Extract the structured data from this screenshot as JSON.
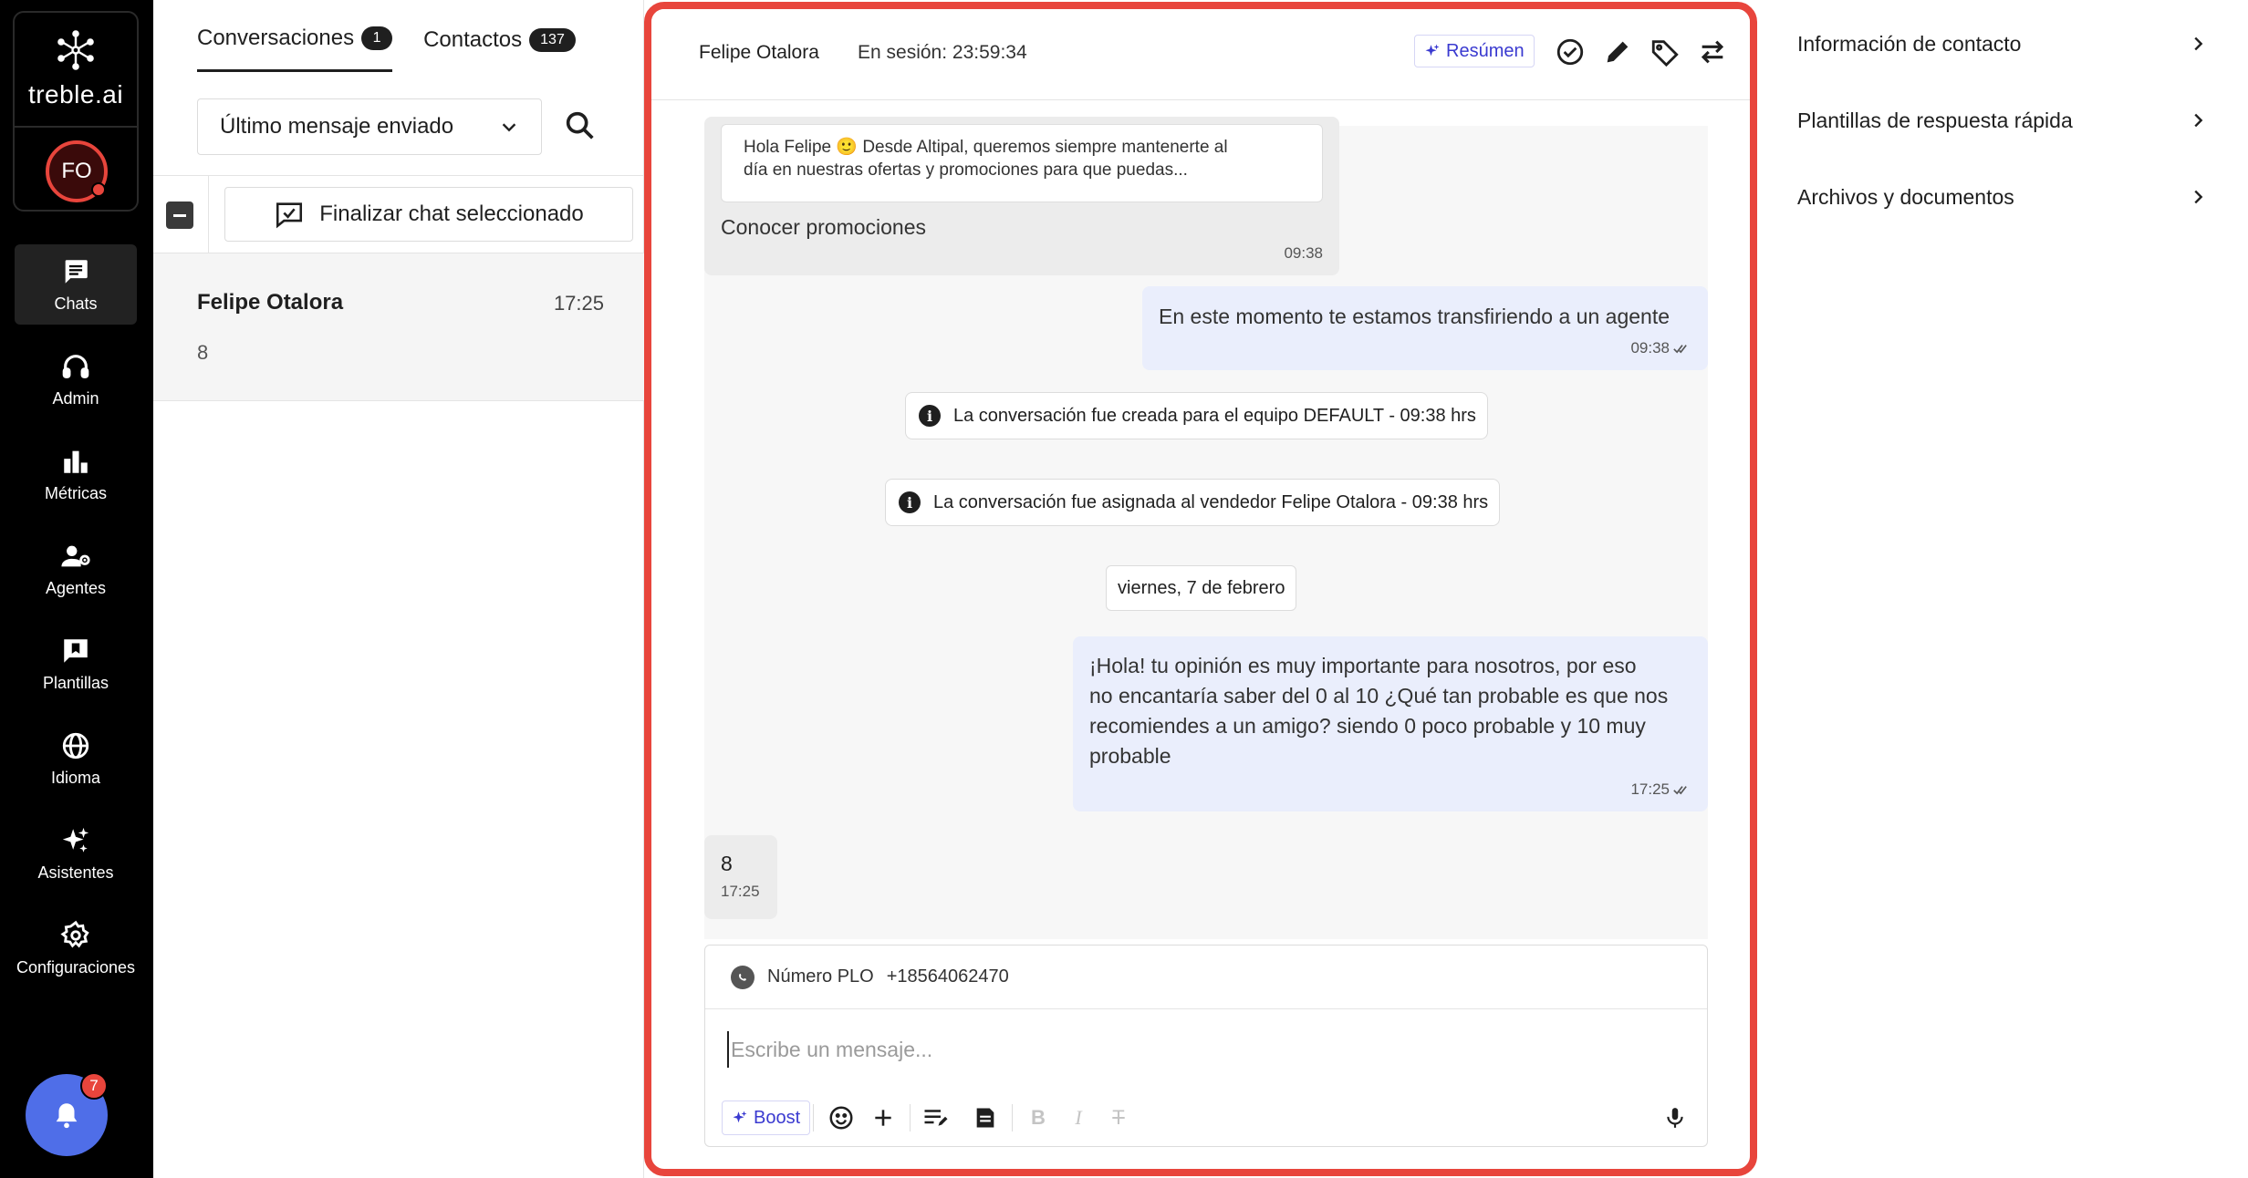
{
  "brand": {
    "name": "treble.ai"
  },
  "user": {
    "initials": "FO"
  },
  "nav": [
    {
      "label": "Chats",
      "icon": "chat-icon"
    },
    {
      "label": "Admin",
      "icon": "headset-icon"
    },
    {
      "label": "Métricas",
      "icon": "bar-chart-icon"
    },
    {
      "label": "Agentes",
      "icon": "agents-icon"
    },
    {
      "label": "Plantillas",
      "icon": "template-icon"
    },
    {
      "label": "Idioma",
      "icon": "globe-icon"
    },
    {
      "label": "Asistentes",
      "icon": "sparkles-icon"
    },
    {
      "label": "Configuraciones",
      "icon": "gear-icon"
    }
  ],
  "notifications": {
    "count": "7"
  },
  "list": {
    "tabs": [
      {
        "label": "Conversaciones",
        "count": "1"
      },
      {
        "label": "Contactos",
        "count": "137"
      }
    ],
    "sort_value": "Último mensaje enviado",
    "finish_label": "Finalizar chat seleccionado",
    "conversations": [
      {
        "name": "Felipe Otalora",
        "time": "17:25",
        "preview": "8"
      }
    ]
  },
  "chat": {
    "contact": "Felipe Otalora",
    "session": "En sesión: 23:59:34",
    "resumen_label": "Resúmen",
    "template": {
      "text_line1": "Hola Felipe 🙂 Desde Altipal, queremos siempre mantenerte al",
      "text_line2": "día en nuestras ofertas y promociones para que puedas...",
      "button_text": "Conocer promociones",
      "time": "09:38"
    },
    "out1": {
      "text": "En este momento te estamos transfiriendo a un agente",
      "time": "09:38"
    },
    "system1": "La conversación fue creada para el equipo DEFAULT - 09:38 hrs",
    "system2": "La conversación fue asignada al vendedor Felipe Otalora - 09:38 hrs",
    "date_chip": "viernes, 7 de febrero",
    "out2": {
      "line1": "¡Hola! tu opinión es muy importante para nosotros, por eso",
      "line2": "no encantaría saber del 0 al 10 ¿Qué tan probable es que nos",
      "line3": "recomiendes a un amigo? siendo 0 poco probable y 10 muy",
      "line4": "probable",
      "time": "17:25"
    },
    "in_last": {
      "text": "8",
      "time": "17:25"
    },
    "composer": {
      "channel_label": "Número PLO",
      "channel_number": "+18564062470",
      "placeholder": "Escribe un mensaje...",
      "boost_label": "Boost"
    }
  },
  "info_panel": {
    "items": [
      "Información de contacto",
      "Plantillas de respuesta rápida",
      "Archivos y documentos"
    ]
  },
  "colors": {
    "accent": "#e8453c",
    "brand_blue": "#4f6ee8",
    "outgoing_bubble": "#eaeefc"
  }
}
